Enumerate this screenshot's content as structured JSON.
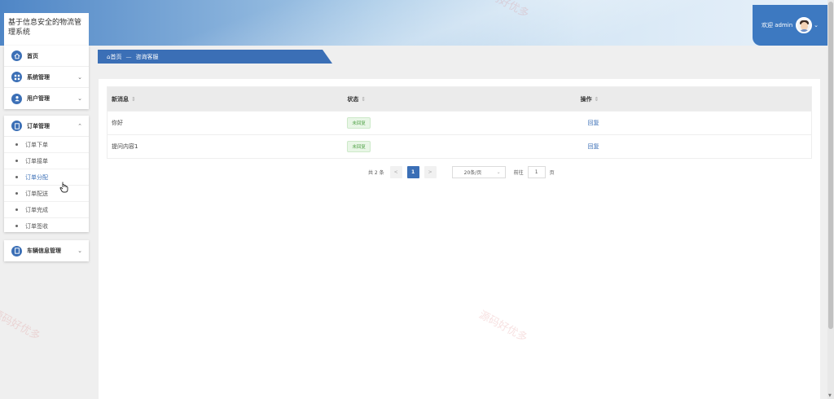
{
  "app": {
    "title": "基于信息安全的物流管理系统"
  },
  "header": {
    "welcome": "欢迎 admin"
  },
  "sidebar": {
    "items": [
      {
        "label": "首页"
      },
      {
        "label": "系统管理"
      },
      {
        "label": "用户管理"
      },
      {
        "label": "订单管理",
        "sub": [
          "订单下单",
          "订单接单",
          "订单分配",
          "订单配送",
          "订单完成",
          "订单签收"
        ]
      },
      {
        "label": "车辆信息管理"
      }
    ]
  },
  "breadcrumb": {
    "home": "首页",
    "current": "咨询客服"
  },
  "table": {
    "headers": [
      "新消息",
      "状态",
      "操作"
    ],
    "rows": [
      {
        "message": "你好",
        "status": "未回复",
        "action": "回复"
      },
      {
        "message": "提问内容1",
        "status": "未回复",
        "action": "回复"
      }
    ]
  },
  "pager": {
    "total": "共 2 条",
    "prev": "<",
    "page": "1",
    "next": ">",
    "size": "20条/页",
    "goto": "前往",
    "goto_value": "1",
    "page_unit": "页"
  },
  "watermarks": [
    "源码好优多",
    "源码好优多",
    "源码好优多"
  ],
  "colors": {
    "primary": "#3b6fb6",
    "header_accent": "#3d79c1",
    "status_green": "#53a34a"
  }
}
